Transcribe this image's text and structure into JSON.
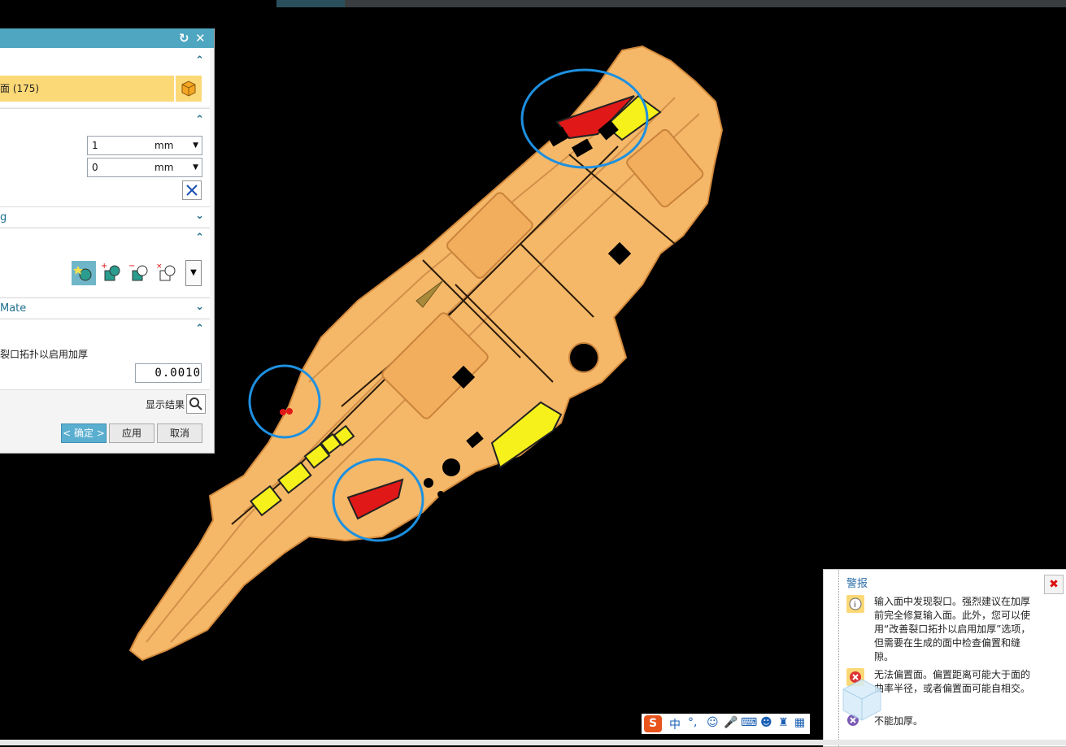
{
  "dialog": {
    "selection_label": "面 (175)",
    "offset1_value": "1",
    "offset1_unit": "mm",
    "offset2_value": "0",
    "offset2_unit": "mm",
    "section_collapsed_label": "g",
    "mate_label": "Mate",
    "repair_option_label": "裂口拓扑以启用加厚",
    "tolerance_value": "0.0010",
    "show_result_label": "显示结果",
    "ok_label": "< 确定 >",
    "apply_label": "应用",
    "cancel_label": "取消"
  },
  "alert": {
    "title": "警报",
    "msg1": "输入面中发现裂口。强烈建议在加厚前完全修复输入面。此外，您可以使用“改善裂口拓扑以启用加厚”选项，但需要在生成的面中检查偏置和缝隙。",
    "msg2": "无法偏置面。偏置距离可能大于面的曲率半径，或者偏置面可能自相交。",
    "msg3": "不能加厚。"
  },
  "ime": {
    "logo": "S",
    "mode": "中",
    "punct": "°,"
  },
  "colors": {
    "model": "#f5b868",
    "highlight_yellow": "#f6f11a",
    "error_red": "#e01818",
    "circle": "#1e90e0",
    "dialog_header": "#4ea6c1"
  }
}
